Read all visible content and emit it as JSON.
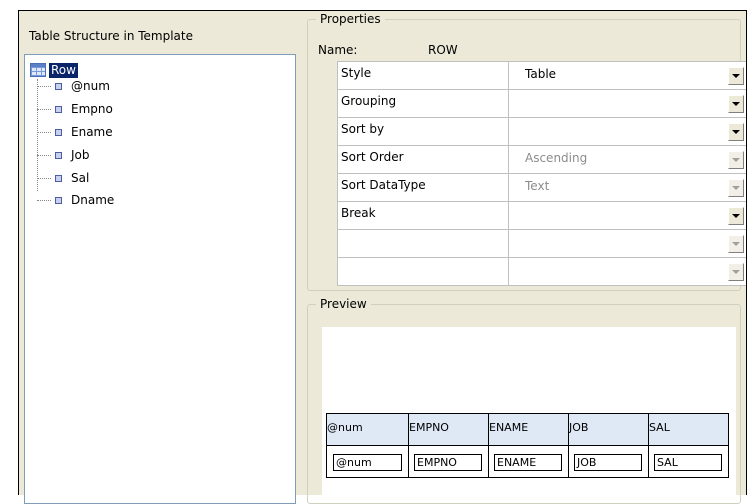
{
  "left_panel": {
    "title": "Table Structure in Template",
    "root_label": "Row",
    "items": [
      "@num",
      "Empno",
      "Ename",
      "Job",
      "Sal",
      "Dname"
    ]
  },
  "properties": {
    "legend": "Properties",
    "name_label": "Name:",
    "name_value": "ROW",
    "rows": [
      {
        "name": "Style",
        "value": "Table",
        "enabled": true
      },
      {
        "name": "Grouping",
        "value": "",
        "enabled": true
      },
      {
        "name": "Sort by",
        "value": "",
        "enabled": true
      },
      {
        "name": "Sort Order",
        "value": "Ascending",
        "enabled": false
      },
      {
        "name": "Sort DataType",
        "value": "Text",
        "enabled": false
      },
      {
        "name": "Break",
        "value": "",
        "enabled": true
      },
      {
        "name": "",
        "value": "",
        "enabled": false
      },
      {
        "name": "",
        "value": "",
        "enabled": false
      }
    ]
  },
  "preview": {
    "legend": "Preview",
    "headers": [
      "@num",
      "EMPNO",
      "ENAME",
      "JOB",
      "SAL"
    ],
    "fields": [
      "@num",
      "EMPNO",
      "ENAME",
      "JOB",
      "SAL"
    ]
  },
  "colors": {
    "selection": "#0a246a",
    "header_fill": "#dfe9f6",
    "panel_bg": "#ece9d8"
  }
}
